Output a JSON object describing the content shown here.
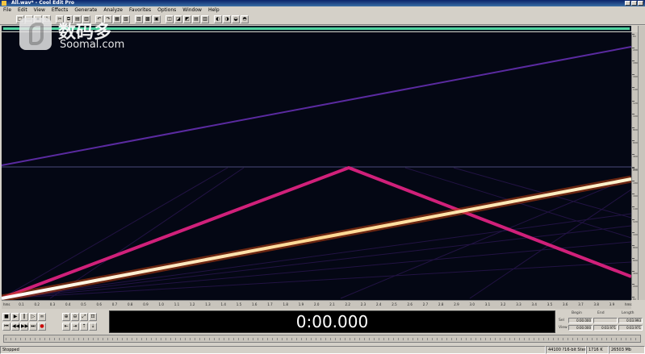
{
  "window": {
    "title": "All.wav* - Cool Edit Pro"
  },
  "menu": [
    "File",
    "Edit",
    "View",
    "Effects",
    "Generate",
    "Analyze",
    "Favorites",
    "Options",
    "Window",
    "Help"
  ],
  "watermark": {
    "cn": "数码多",
    "en": "Soomal.com"
  },
  "colors": {
    "background": "#040714",
    "overview_bar": "#4fd3a0",
    "sweep_bright": "#ffe0a0",
    "sweep_magenta": "#d0207a",
    "sweep_violet": "#5a2aa0"
  },
  "time_display": "0:00.000",
  "selection": {
    "headers": [
      "Begin",
      "End",
      "Length"
    ],
    "rows": [
      {
        "label": "Sel",
        "begin": "0:00.000",
        "end": "",
        "length": "0:03.993"
      },
      {
        "label": "View",
        "begin": "0:00.000",
        "end": "0:03.971",
        "length": "0:03.971"
      }
    ]
  },
  "status": {
    "state": "Stopped",
    "format": "44100 ?16-bit Stereo",
    "size": "1716 K",
    "free": "26503 Mb"
  },
  "freq_ruler_top": [
    "Hz",
    "20000",
    "18000",
    "16000",
    "14000",
    "12000",
    "10000",
    "8000",
    "6000",
    "4000",
    "2000"
  ],
  "freq_ruler_bottom": [
    "20000",
    "18000",
    "16000",
    "14000",
    "12000",
    "10000",
    "8000",
    "6000",
    "4000",
    "2000",
    "Hz"
  ],
  "timeline": [
    "hms",
    "0.1",
    "0.2",
    "0.3",
    "0.4",
    "0.5",
    "0.6",
    "0.7",
    "0.8",
    "0.9",
    "1.0",
    "1.1",
    "1.2",
    "1.3",
    "1.4",
    "1.5",
    "1.6",
    "1.7",
    "1.8",
    "1.9",
    "2.0",
    "2.1",
    "2.2",
    "2.3",
    "2.4",
    "2.5",
    "2.6",
    "2.7",
    "2.8",
    "2.9",
    "3.0",
    "3.1",
    "3.2",
    "3.3",
    "3.4",
    "3.5",
    "3.6",
    "3.7",
    "3.8",
    "3.9",
    "hms"
  ]
}
